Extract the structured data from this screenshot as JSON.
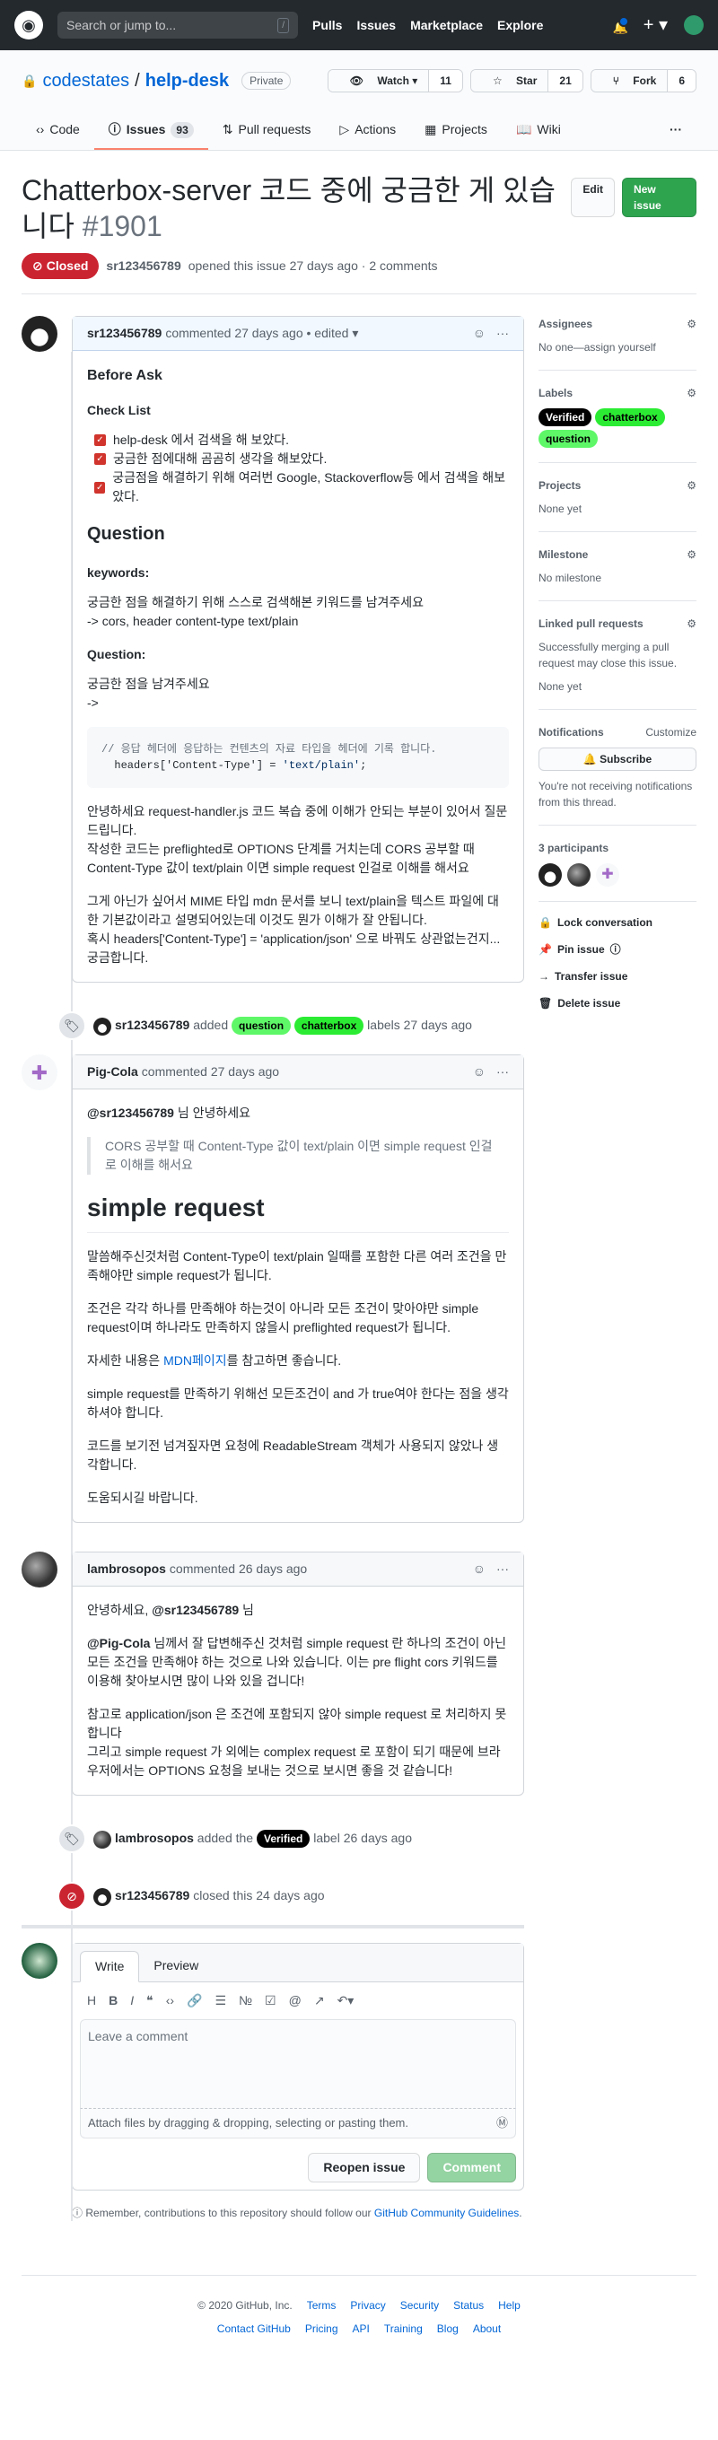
{
  "header": {
    "search_placeholder": "Search or jump to...",
    "search_key": "/",
    "nav": [
      "Pulls",
      "Issues",
      "Marketplace",
      "Explore"
    ]
  },
  "repo": {
    "owner": "codestates",
    "sep": "/",
    "name": "help-desk",
    "visibility": "Private",
    "watch": "Watch",
    "watch_count": "11",
    "star": "Star",
    "star_count": "21",
    "fork": "Fork",
    "fork_count": "6"
  },
  "tabs": [
    {
      "label": "Code"
    },
    {
      "label": "Issues",
      "count": "93"
    },
    {
      "label": "Pull requests"
    },
    {
      "label": "Actions"
    },
    {
      "label": "Projects"
    },
    {
      "label": "Wiki"
    }
  ],
  "issue": {
    "title": "Chatterbox-server 코드 중에 궁금한 게 있습니다",
    "number": "#1901",
    "edit": "Edit",
    "new_issue": "New issue",
    "state": "Closed",
    "author": "sr123456789",
    "meta": "opened this issue 27 days ago · 2 comments"
  },
  "comment1": {
    "author": "sr123456789",
    "meta": "commented 27 days ago • edited",
    "h_before": "Before Ask",
    "h_check": "Check List",
    "tasks": [
      "help-desk 에서 검색을 해 보았다.",
      "궁금한 점에대해 곰곰히 생각을 해보았다.",
      "궁금점을 해결하기 위해 여러번 Google, Stackoverflow등 에서 검색을 해보았다."
    ],
    "h_question": "Question",
    "h_keywords": "keywords:",
    "kw_text1": "궁금한 점을 해결하기 위해 스스로 검색해본 키워드를 남겨주세요",
    "kw_text2": "-> cors, header content-type text/plain",
    "h_q2": "Question:",
    "q_text1": "궁금한 점을 남겨주세요",
    "q_text2": "->",
    "code_comment": "// 응답 헤더에 응답하는 컨텐츠의 자료 타입을 헤더에 기록 합니다.",
    "code_line_a": "headers['Content-Type'] = ",
    "code_line_b": "'text/plain'",
    "code_line_c": ";",
    "p1": "안녕하세요 request-handler.js 코드 복습 중에 이해가 안되는 부분이 있어서 질문드립니다.",
    "p2": "작성한 코드는 preflighted로 OPTIONS 단계를 거치는데 CORS 공부할 때 Content-Type 값이 text/plain 이면 simple request 인걸로 이해를 해서요",
    "p3": "그게 아닌가 싶어서 MIME 타입 mdn 문서를 보니 text/plain을 텍스트 파일에 대한 기본값이라고 설명되어있는데 이것도 뭔가 이해가 잘 안됩니다.",
    "p4": "혹시 headers['Content-Type'] = 'application/json' 으로 바꿔도 상관없는건지...궁금합니다."
  },
  "event1": {
    "actor": "sr123456789",
    "added": "added",
    "labels": [
      "question",
      "chatterbox"
    ],
    "suffix": "labels 27 days ago"
  },
  "comment2": {
    "author": "Pig-Cola",
    "meta": "commented 27 days ago",
    "greet_mention": "@sr123456789",
    "greet_rest": " 님 안녕하세요",
    "quote": "CORS 공부할 때 Content-Type 값이 text/plain 이면 simple request 인걸로 이해를 해서요",
    "h1": "simple request",
    "p1": "말씀해주신것처럼 Content-Type이 text/plain 일때를 포함한 다른 여러 조건을 만족해야만 simple request가 됩니다.",
    "p2": "조건은 각각 하나를 만족해야 하는것이 아니라 모든 조건이 맞아야만 simple request이며 하나라도 만족하지 않을시 preflighted request가 됩니다.",
    "p3_a": "자세한 내용은 ",
    "p3_link": "MDN페이지",
    "p3_b": "를 참고하면 좋습니다.",
    "p4": "simple request를 만족하기 위해선 모든조건이 and 가 true여야 한다는 점을 생각하셔야 합니다.",
    "p5": "코드를 보기전 넘겨짚자면 요청에 ReadableStream 객체가 사용되지 않았나 생각합니다.",
    "p6": "도움되시길 바랍니다."
  },
  "comment3": {
    "author": "lambrosopos",
    "meta": "commented 26 days ago",
    "greet_a": "안녕하세요, ",
    "greet_mention": "@sr123456789",
    "greet_b": " 님",
    "p1_mention": "@Pig-Cola",
    "p1_rest": " 님께서 잘 답변해주신 것처럼 simple request 란 하나의 조건이 아닌 모든 조건을 만족해야 하는 것으로 나와 있습니다. 이는 pre flight cors 키워드를 이용해 찾아보시면 많이 나와 있을 겁니다!",
    "p2": "참고로 application/json 은 조건에 포함되지 않아 simple request 로 처리하지 못합니다",
    "p3": "그리고 simple request 가 외에는 complex request 로 포함이 되기 때문에 브라우저에서는 OPTIONS 요청을 보내는 것으로 보시면 좋을 것 같습니다!"
  },
  "event2": {
    "actor": "lambrosopos",
    "text_a": "added the",
    "label": "Verified",
    "text_b": "label 26 days ago"
  },
  "event3": {
    "actor": "sr123456789",
    "text": "closed this 24 days ago"
  },
  "editor": {
    "tab_write": "Write",
    "tab_preview": "Preview",
    "placeholder": "Leave a comment",
    "attach": "Attach files by dragging & dropping, selecting or pasting them.",
    "reopen": "Reopen issue",
    "comment": "Comment"
  },
  "remember": {
    "text": "Remember, contributions to this repository should follow our ",
    "link": "GitHub Community Guidelines",
    "end": "."
  },
  "sidebar": {
    "assignees": "Assignees",
    "assignees_val_a": "No one—",
    "assignees_val_b": "assign yourself",
    "labels": "Labels",
    "label_items": [
      "Verified",
      "chatterbox",
      "question"
    ],
    "projects": "Projects",
    "projects_val": "None yet",
    "milestone": "Milestone",
    "milestone_val": "No milestone",
    "linked": "Linked pull requests",
    "linked_desc": "Successfully merging a pull request may close this issue.",
    "linked_val": "None yet",
    "notifications": "Notifications",
    "customize": "Customize",
    "subscribe": "Subscribe",
    "notif_desc": "You're not receiving notifications from this thread.",
    "participants": "3 participants",
    "lock": "Lock conversation",
    "pin": "Pin issue",
    "transfer": "Transfer issue",
    "delete": "Delete issue"
  },
  "footer": {
    "copyright": "© 2020 GitHub, Inc.",
    "row1": [
      "Terms",
      "Privacy",
      "Security",
      "Status",
      "Help"
    ],
    "row2": [
      "Contact GitHub",
      "Pricing",
      "API",
      "Training",
      "Blog",
      "About"
    ]
  },
  "colors": {
    "closed": "#cb2431",
    "accent": "#0366d6",
    "green": "#2ea44f",
    "tab_underline": "#f9826c"
  }
}
